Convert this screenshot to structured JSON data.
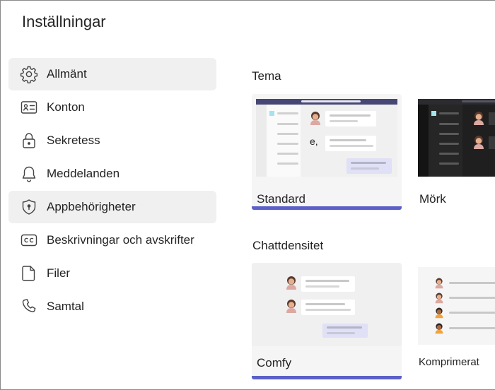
{
  "header": {
    "title": "Inställningar"
  },
  "sidebar": {
    "items": [
      {
        "label": "Allmänt",
        "icon": "gear-icon"
      },
      {
        "label": "Konton",
        "icon": "id-card-icon"
      },
      {
        "label": "Sekretess",
        "icon": "lock-icon"
      },
      {
        "label": "Meddelanden",
        "icon": "bell-icon"
      },
      {
        "label": "Appbehörigheter",
        "icon": "shield-icon"
      },
      {
        "label": "Beskrivningar och avskrifter",
        "icon": "cc-icon"
      },
      {
        "label": "Filer",
        "icon": "file-icon"
      },
      {
        "label": "Samtal",
        "icon": "phone-icon"
      }
    ]
  },
  "theme": {
    "title": "Tema",
    "options": [
      {
        "label": "Standard",
        "preview_text": "e,"
      },
      {
        "label": "Mörk"
      }
    ]
  },
  "density": {
    "title": "Chattdensitet",
    "options": [
      {
        "label": "Comfy"
      },
      {
        "label": "Komprimerat"
      }
    ]
  },
  "colors": {
    "accent": "#5b5fc7",
    "hover": "#f0f0f0"
  }
}
